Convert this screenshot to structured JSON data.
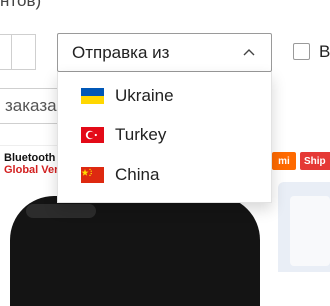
{
  "header": {
    "clipped_text": "нтов)"
  },
  "filters": {
    "ship_from": {
      "label": "Отправка из",
      "options": [
        {
          "label": "Ukraine",
          "flag": "ukraine-flag",
          "colors": [
            "#0057B7",
            "#FFD700"
          ]
        },
        {
          "label": "Turkey",
          "flag": "turkey-flag",
          "colors": [
            "#E30A17",
            "#FFFFFF"
          ]
        },
        {
          "label": "China",
          "flag": "china-flag",
          "colors": [
            "#DE2910",
            "#FFDE00"
          ]
        }
      ]
    },
    "checkbox_label": "B",
    "search_value": "заказа"
  },
  "products": {
    "left_promo_line1": "Bluetooth",
    "left_promo_line2": "Global Ver",
    "right_badge_brand": "mi",
    "right_badge_ship": "Ship"
  },
  "colors": {
    "border": "#9a9a9a",
    "accent_red": "#d32020",
    "brand_orange": "#ff6a00"
  }
}
